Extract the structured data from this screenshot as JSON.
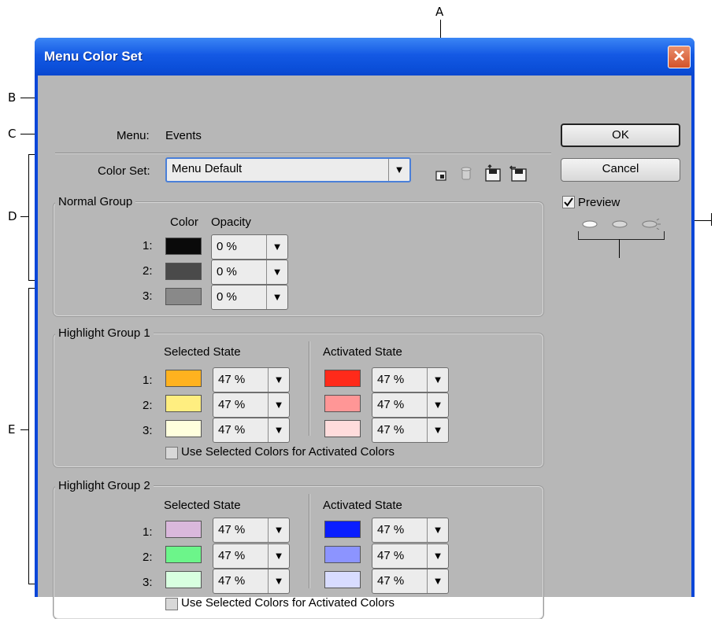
{
  "callouts": {
    "a": "A",
    "b": "B",
    "c": "C",
    "d": "D",
    "e": "E"
  },
  "dialog": {
    "title": "Menu Color Set",
    "close_glyph": "✕"
  },
  "menu": {
    "label": "Menu:",
    "value": "Events"
  },
  "color_set": {
    "label": "Color Set:",
    "value": "Menu Default",
    "toolbar_icons": [
      "new-color-set-icon",
      "delete-color-set-icon",
      "save-color-set-icon",
      "save-as-color-set-icon"
    ]
  },
  "buttons": {
    "ok": "OK",
    "cancel": "Cancel"
  },
  "preview": {
    "label": "Preview",
    "checked": true,
    "icons": [
      "button-normal-icon",
      "button-selected-icon",
      "button-activated-icon"
    ]
  },
  "dropdown_arrow": "▼",
  "normal_group": {
    "title": "Normal Group",
    "color_header": "Color",
    "opacity_header": "Opacity",
    "rows": [
      {
        "label": "1:",
        "color": "#0a0a0a",
        "opacity": "0 %"
      },
      {
        "label": "2:",
        "color": "#4a4a4a",
        "opacity": "0 %"
      },
      {
        "label": "3:",
        "color": "#898989",
        "opacity": "0 %"
      }
    ]
  },
  "highlight_group_1": {
    "title": "Highlight Group 1",
    "selected_header": "Selected State",
    "activated_header": "Activated State",
    "rows": [
      {
        "label": "1:",
        "selected_color": "#ffb21f",
        "selected_opacity": "47 %",
        "activated_color": "#ff2a1a",
        "activated_opacity": "47 %"
      },
      {
        "label": "2:",
        "selected_color": "#ffee80",
        "selected_opacity": "47 %",
        "activated_color": "#ff9696",
        "activated_opacity": "47 %"
      },
      {
        "label": "3:",
        "selected_color": "#ffffdd",
        "selected_opacity": "47 %",
        "activated_color": "#ffdcdc",
        "activated_opacity": "47 %"
      }
    ],
    "use_selected_label": "Use Selected Colors for Activated Colors"
  },
  "highlight_group_2": {
    "title": "Highlight Group 2",
    "selected_header": "Selected State",
    "activated_header": "Activated State",
    "rows": [
      {
        "label": "1:",
        "selected_color": "#dab8dc",
        "selected_opacity": "47 %",
        "activated_color": "#0a1eff",
        "activated_opacity": "47 %"
      },
      {
        "label": "2:",
        "selected_color": "#6cf58a",
        "selected_opacity": "47 %",
        "activated_color": "#8c94ff",
        "activated_opacity": "47 %"
      },
      {
        "label": "3:",
        "selected_color": "#d8ffe0",
        "selected_opacity": "47 %",
        "activated_color": "#d8dcff",
        "activated_opacity": "47 %"
      }
    ],
    "use_selected_label": "Use Selected Colors for Activated Colors"
  }
}
